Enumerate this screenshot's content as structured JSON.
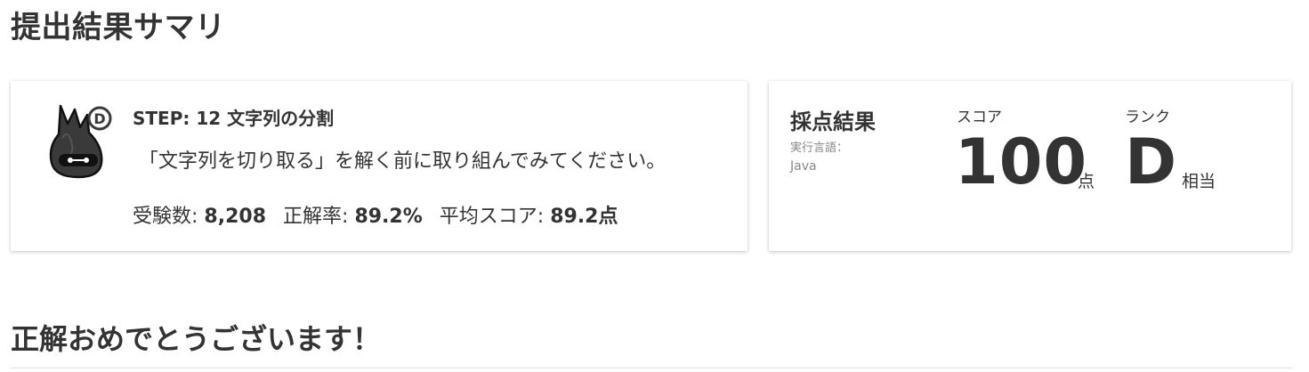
{
  "page": {
    "title": "提出結果サマリ",
    "congrats": "正解おめでとうございます！"
  },
  "step": {
    "rank_badge": "D",
    "title": "STEP: 12 文字列の分割",
    "description": "「文字列を切り取る」を解く前に取り組んでみてください。",
    "stats": {
      "examinees_label": "受験数:",
      "examinees_value": "8,208",
      "accuracy_label": "正解率:",
      "accuracy_value": "89.2%",
      "avg_label": "平均スコア:",
      "avg_value": "89.2点"
    }
  },
  "result": {
    "title": "採点結果",
    "lang_label": "実行言語：",
    "lang_value": "Java",
    "score_label": "スコア",
    "score_value": "100",
    "score_unit": "点",
    "rank_label": "ランク",
    "rank_value": "D",
    "rank_unit": "相当"
  },
  "colors": {
    "text": "#333333",
    "muted": "#888888",
    "card_bg": "#ffffff",
    "mascot_body": "#3a3a3a"
  }
}
